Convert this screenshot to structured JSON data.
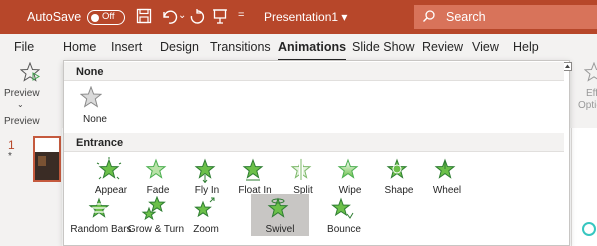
{
  "titlebar": {
    "autosave_label": "AutoSave",
    "autosave_state": "Off",
    "doc_title": "Presentation1",
    "title_caret": "▾",
    "search_label": "Search",
    "qa_caret": "⌄",
    "customize_glyph": "="
  },
  "tabs": [
    {
      "label": "File"
    },
    {
      "label": "Home"
    },
    {
      "label": "Insert"
    },
    {
      "label": "Design"
    },
    {
      "label": "Transitions"
    },
    {
      "label": "Animations",
      "active": true
    },
    {
      "label": "Slide Show"
    },
    {
      "label": "Review"
    },
    {
      "label": "View"
    },
    {
      "label": "Help"
    }
  ],
  "ribbon": {
    "preview_label": "Preview",
    "preview_group": "Preview",
    "preview_chevron": "⌄",
    "effect_label_1": "Eff",
    "effect_label_2": "Optic"
  },
  "slides": {
    "number": "1",
    "anim_marker": "*"
  },
  "gallery": {
    "none_section": "None",
    "entrance_section": "Entrance",
    "none_items": [
      {
        "label": "None",
        "icon": "star-gray-icon"
      }
    ],
    "entrance_row1": [
      {
        "label": "Appear",
        "icon": "appear-star-icon"
      },
      {
        "label": "Fade",
        "icon": "fade-star-icon"
      },
      {
        "label": "Fly In",
        "icon": "fly-in-star-icon"
      },
      {
        "label": "Float In",
        "icon": "float-in-star-icon"
      },
      {
        "label": "Split",
        "icon": "split-star-icon"
      },
      {
        "label": "Wipe",
        "icon": "wipe-star-icon"
      },
      {
        "label": "Shape",
        "icon": "shape-star-icon"
      },
      {
        "label": "Wheel",
        "icon": "wheel-star-icon"
      }
    ],
    "entrance_row2": [
      {
        "label": "Random Bars",
        "icon": "random-bars-star-icon"
      },
      {
        "label": "Grow & Turn",
        "icon": "grow-turn-star-icon"
      },
      {
        "label": "Zoom",
        "icon": "zoom-star-icon"
      },
      {
        "label": "Swivel",
        "icon": "swivel-star-icon",
        "selected": true
      },
      {
        "label": "Bounce",
        "icon": "bounce-star-icon"
      }
    ]
  },
  "colors": {
    "accent": "#b7472a",
    "entrance_green": "#3fa34d",
    "selected_bg": "#c8c6c4"
  }
}
